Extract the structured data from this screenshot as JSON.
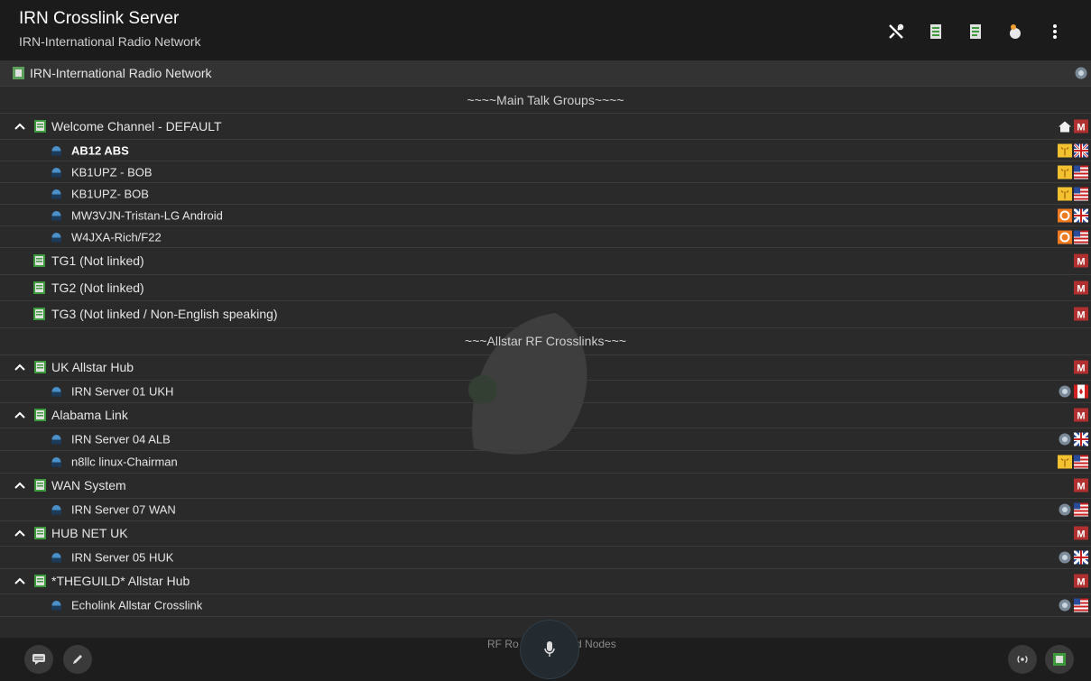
{
  "app": {
    "title": "IRN Crosslink Server",
    "subtitle": "IRN-International Radio Network"
  },
  "toolbar": {
    "icons": [
      "tools-icon",
      "channel-add-icon",
      "channel-edit-icon",
      "user-status-icon",
      "overflow-menu-icon"
    ]
  },
  "server_row": {
    "label": "IRN-International Radio Network"
  },
  "sections": {
    "main": "~~~~Main Talk Groups~~~~",
    "allstar": "~~~Allstar RF Crosslinks~~~",
    "peek_left": "RF Ro",
    "peek_right": "und Nodes"
  },
  "channels": [
    {
      "name": "Welcome Channel - DEFAULT",
      "expanded": true,
      "badges": [
        "home-icon",
        "m-badge-icon"
      ],
      "users": [
        {
          "name": "AB12 ABS",
          "bold": true,
          "badges": [
            "signal-icon",
            "uk-flag-icon"
          ]
        },
        {
          "name": "KB1UPZ - BOB",
          "badges": [
            "signal-icon",
            "us-flag-icon"
          ]
        },
        {
          "name": "KB1UPZ- BOB",
          "badges": [
            "signal-icon",
            "us-flag-icon"
          ]
        },
        {
          "name": "MW3VJN-Tristan-LG Android",
          "badges": [
            "android-icon",
            "uk-flag-icon"
          ]
        },
        {
          "name": "W4JXA-Rich/F22",
          "badges": [
            "android-icon",
            "us-flag-icon"
          ]
        }
      ]
    },
    {
      "name": "TG1 (Not linked)",
      "expanded": false,
      "badges": [
        "m-badge-icon"
      ],
      "users": []
    },
    {
      "name": "TG2 (Not linked)",
      "expanded": false,
      "badges": [
        "m-badge-icon"
      ],
      "users": []
    },
    {
      "name": "TG3 (Not linked / Non-English speaking)",
      "expanded": false,
      "badges": [
        "m-badge-icon"
      ],
      "users": []
    }
  ],
  "allstar_channels": [
    {
      "name": "UK Allstar Hub",
      "users": [
        {
          "name": "IRN Server 01 UKH",
          "badges": [
            "server-icon",
            "canada-flag-icon"
          ]
        }
      ]
    },
    {
      "name": "Alabama Link",
      "users": [
        {
          "name": "IRN Server 04 ALB",
          "badges": [
            "server-icon",
            "uk-flag-icon"
          ]
        },
        {
          "name": "n8llc linux-Chairman",
          "badges": [
            "signal-icon",
            "us-flag-icon"
          ]
        }
      ]
    },
    {
      "name": "WAN System",
      "users": [
        {
          "name": "IRN Server 07 WAN",
          "badges": [
            "server-icon",
            "us-flag-icon"
          ]
        }
      ]
    },
    {
      "name": "HUB NET UK",
      "users": [
        {
          "name": "IRN Server 05 HUK",
          "badges": [
            "server-icon",
            "uk-flag-icon"
          ]
        }
      ]
    },
    {
      "name": "*THEGUILD* Allstar Hub",
      "users": [
        {
          "name": "Echolink Allstar Crosslink",
          "badges": [
            "server-icon",
            "us-flag-icon"
          ]
        }
      ]
    }
  ],
  "colors": {
    "appbar": "#1b1b1b",
    "background": "#2a2a2a",
    "accent_green": "#3d9a3d",
    "m_badge": "#b03030"
  }
}
